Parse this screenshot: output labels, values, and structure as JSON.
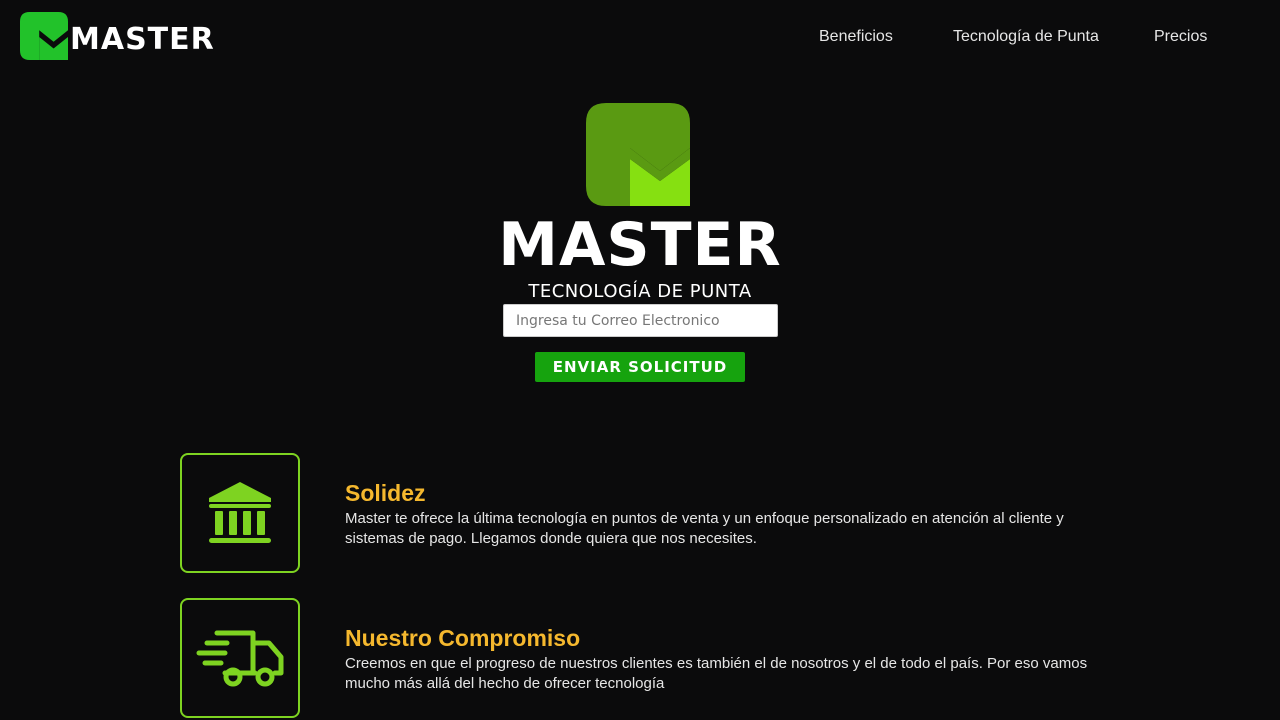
{
  "brand": {
    "name": "MASTER",
    "tagline": "TECNOLOGÍA DE PUNTA",
    "colors": {
      "mark_dark": "#5a9a12",
      "mark_light": "#86e011",
      "nav_mark": "#22c22a",
      "accent_title": "#f5b82e",
      "button": "#16a30e",
      "icon_stroke": "#7ed321"
    }
  },
  "nav": {
    "links": [
      {
        "label": "Beneficios"
      },
      {
        "label": "Tecnología de Punta"
      },
      {
        "label": "Precios"
      }
    ]
  },
  "hero": {
    "email_placeholder": "Ingresa tu Correo Electronico",
    "email_value": "",
    "submit_label": "ENVIAR SOLICITUD"
  },
  "features": [
    {
      "icon": "bank-icon",
      "title": "Solidez",
      "text": "Master te ofrece la última tecnología en puntos de venta y un enfoque personalizado en atención al cliente y sistemas de pago. Llegamos donde quiera que nos necesites."
    },
    {
      "icon": "delivery-truck-icon",
      "title": "Nuestro Compromiso",
      "text": "Creemos en que el progreso de nuestros clientes es también el de nosotros y el de todo el país. Por eso vamos mucho más allá del hecho de ofrecer tecnología"
    }
  ]
}
